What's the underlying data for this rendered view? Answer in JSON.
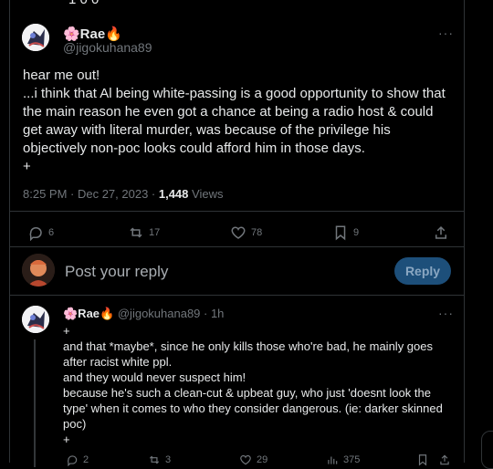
{
  "top_cut_text": "1 0 0",
  "main_post": {
    "display_name": "🌸Rae🔥",
    "handle": "@jigokuhana89",
    "more_label": "···",
    "text": "hear me out!\n...i think that Al being white-passing is a good opportunity to show that the main reason he even got a chance at being a radio host & could get away with literal murder, was because of the privilege his objectively non-poc looks could afford him in those days.\n+",
    "time": "8:25 PM · Dec 27, 2023 · ",
    "views_count": "1,448",
    "views_label": " Views",
    "actions": {
      "replies": "6",
      "reposts": "17",
      "likes": "78",
      "bookmarks": "9"
    }
  },
  "reply_box": {
    "placeholder": "Post your reply",
    "button_label": "Reply"
  },
  "reply_post": {
    "display_name": "🌸Rae🔥",
    "handle_time": "@jigokuhana89 · 1h",
    "more_label": "···",
    "text": "+\nand that *maybe*, since he only kills those who're bad, he mainly goes after racist white ppl.\nand they would never suspect him!\nbecause he's such a clean-cut & upbeat guy, who just 'doesnt look the type' when it comes to who they consider dangerous. (ie: darker skinned poc)\n+",
    "actions": {
      "replies": "2",
      "reposts": "3",
      "likes": "29",
      "views": "375"
    }
  }
}
